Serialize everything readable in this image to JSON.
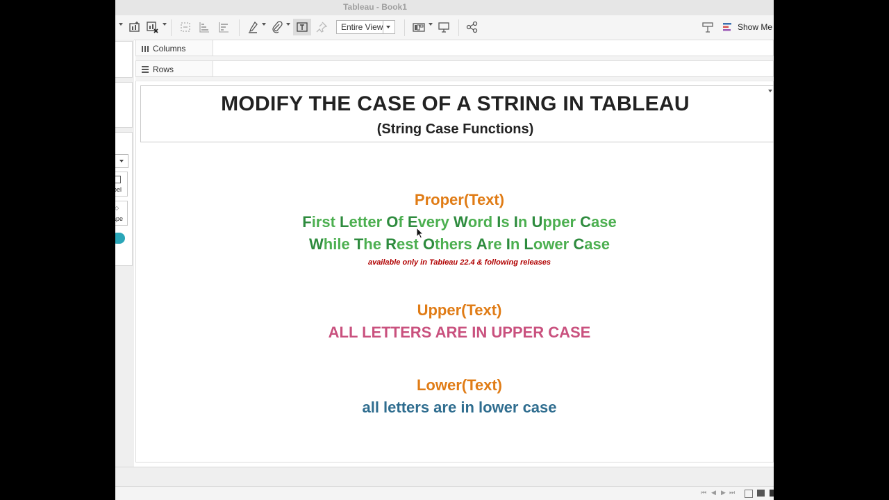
{
  "window": {
    "title": "Tableau - Book1"
  },
  "toolbar": {
    "fit_value": "Entire View",
    "show_me_label": "Show Me"
  },
  "shelves": {
    "columns": "Columns",
    "rows": "Rows"
  },
  "left_panel": {
    "label_fragment": "bel",
    "shape_fragment": "ape"
  },
  "view": {
    "title": "MODIFY THE CASE OF A STRING IN TABLEAU",
    "subtitle": "(String Case Functions)",
    "proper": {
      "function": "Proper(Text)",
      "line1": "First Letter Of Every Word Is In Upper Case",
      "line2": "While The Rest Others Are In Lower Case",
      "note": "available only in Tableau 22.4 & following releases"
    },
    "upper": {
      "function": "Upper(Text)",
      "example": "ALL LETTERS ARE IN UPPER CASE"
    },
    "lower": {
      "function": "Lower(Text)",
      "example": "all letters are in lower case"
    }
  },
  "colors": {
    "function": "#e07c16",
    "proper_example": "#4caf50",
    "upper_example": "#c9517e",
    "lower_example": "#2f6d8f",
    "note": "#b00000",
    "accent_teal": "#2aa6b8"
  }
}
